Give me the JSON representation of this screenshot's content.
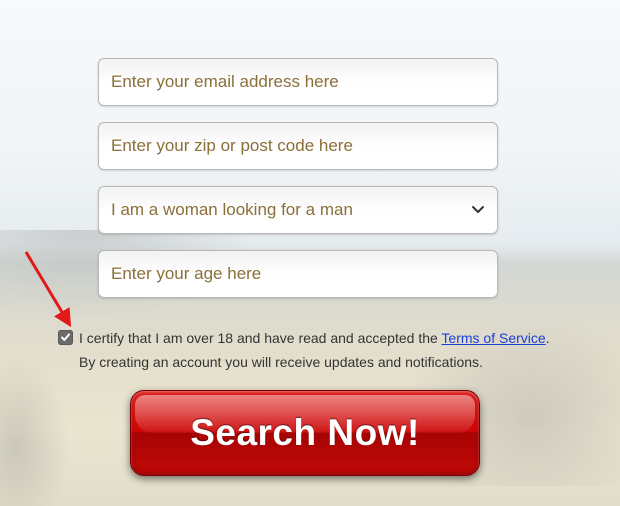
{
  "fields": {
    "email_placeholder": "Enter your email address here",
    "zip_placeholder": "Enter your zip or post code here",
    "gender_selected": "I am a woman looking for a man",
    "age_placeholder": "Enter your age here"
  },
  "terms": {
    "prefix": "I certify that I am over 18 and have read and accepted the ",
    "link_label": "Terms of Service",
    "suffix": ".",
    "line2": "By creating an account you will receive updates and notifications.",
    "checked": true
  },
  "button": {
    "label": "Search Now!"
  },
  "annotation": {
    "arrow_color": "#e11919"
  }
}
